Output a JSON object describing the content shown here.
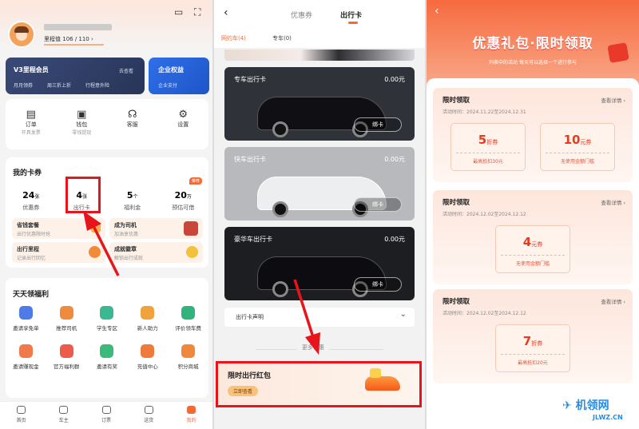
{
  "left": {
    "mileage_label": "里程值",
    "mileage_value": "106 / 110",
    "member": {
      "title": "V3里程会员",
      "enter": "去查看",
      "badges": [
        "月月领券",
        "周三折上折",
        "行程意外险"
      ]
    },
    "enterprise": {
      "title": "企业权益",
      "badges": [
        "企业支付"
      ]
    },
    "quick": [
      {
        "label": "订单",
        "sub": "开具发票",
        "icon": "order-icon"
      },
      {
        "label": "钱包",
        "sub": "零钱提现",
        "icon": "wallet-icon"
      },
      {
        "label": "客服",
        "sub": "",
        "icon": "service-icon"
      },
      {
        "label": "设置",
        "sub": "",
        "icon": "settings-icon"
      }
    ],
    "cards_title": "我的卡券",
    "card_stats": [
      {
        "num": "24",
        "unit": "张",
        "label": "优惠券"
      },
      {
        "num": "4",
        "unit": "张",
        "label": "出行卡"
      },
      {
        "num": "5",
        "unit": "个",
        "label": "福利金"
      },
      {
        "num": "20",
        "unit": "万",
        "label": "预估可借"
      }
    ],
    "recommend_badge": "推荐",
    "promos": [
      {
        "title": "省钱套餐",
        "sub": "出行优惠限时抢"
      },
      {
        "title": "成为司机",
        "sub": "加油享优惠"
      },
      {
        "title": "出行里程",
        "sub": "记录出行回忆"
      },
      {
        "title": "成就徽章",
        "sub": "解锁出行成就"
      }
    ],
    "welfare_title": "天天领福利",
    "welfare": [
      {
        "label": "邀请享免单",
        "color": "#4e7be8"
      },
      {
        "label": "推荐司机",
        "color": "#f08a3c"
      },
      {
        "label": "学生专区",
        "color": "#3ab891"
      },
      {
        "label": "新人助力",
        "color": "#f0a23c"
      },
      {
        "label": "评价领车费",
        "color": "#32b27c"
      },
      {
        "label": "邀请赚现金",
        "color": "#f07a4a"
      },
      {
        "label": "官方福利群",
        "color": "#ef5b4a"
      },
      {
        "label": "邀请有奖",
        "color": "#3cba7a"
      },
      {
        "label": "充值中心",
        "color": "#f07a3c"
      },
      {
        "label": "积分商城",
        "color": "#f0883c"
      }
    ],
    "tabs": [
      "首页",
      "车主",
      "订票",
      "送货",
      "我的"
    ],
    "active_tab": "我的"
  },
  "mid": {
    "tabs": [
      "优惠券",
      "出行卡"
    ],
    "active_tab": "出行卡",
    "subtabs": [
      "网约车(4)",
      "专车(0)"
    ],
    "cards": [
      {
        "name": "专车出行卡",
        "amount": "0.00元",
        "btn": "绑卡",
        "bg": "#2f3238"
      },
      {
        "name": "快车出行卡",
        "amount": "0.00元",
        "btn": "绑卡",
        "bg": "#b8b9bd"
      },
      {
        "name": "豪华车出行卡",
        "amount": "0.00元",
        "btn": "绑卡",
        "bg": "#1d1e22"
      }
    ],
    "statement": "出行卡声明",
    "more": "更多优惠",
    "promo_title": "限时出行红包",
    "promo_btn": "立即查看"
  },
  "right": {
    "title": "优惠礼包·限时领取",
    "subtitle": "列表中的活动 每天可以选择一个进行参与",
    "sections": [
      {
        "title": "限时领取",
        "link": "查看详情 ›",
        "time": "活动时间：2024.11.22至2024.12.31",
        "coupons": [
          {
            "num": "5",
            "unit": "折券",
            "cond": "最高抵扣30元"
          },
          {
            "num": "10",
            "unit": "元券",
            "cond": "无使用金额门槛"
          }
        ]
      },
      {
        "title": "限时领取",
        "link": "查看详情 ›",
        "time": "活动时间：2024.12.02至2024.12.12",
        "coupons": [
          {
            "num": "4",
            "unit": "元券",
            "cond": "无使用金额门槛"
          }
        ]
      },
      {
        "title": "限时领取",
        "link": "查看详情 ›",
        "time": "活动时间：2024.12.02至2024.12.12",
        "coupons": [
          {
            "num": "7",
            "unit": "折券",
            "cond": "最高抵扣20元"
          }
        ]
      }
    ],
    "watermark": "机领网",
    "watermark_url": "JLWZ.CN"
  }
}
